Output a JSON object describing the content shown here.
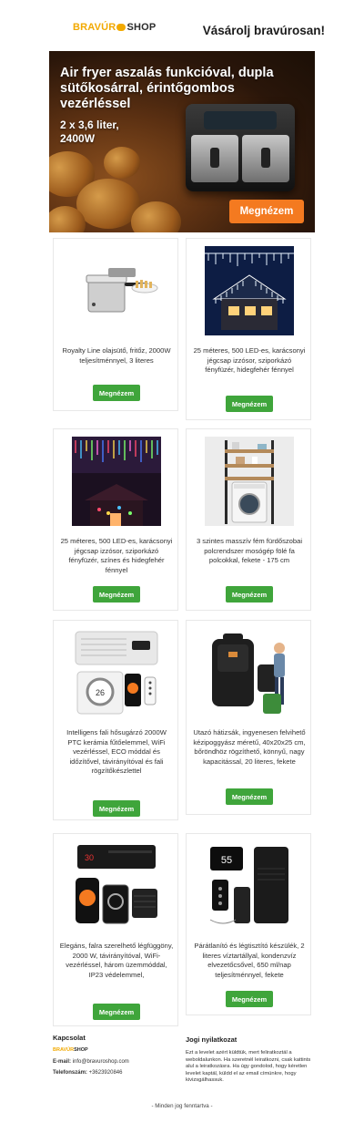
{
  "header": {
    "logo_part1": "BRAVÚR",
    "logo_part2": "SHOP",
    "slogan": "Vásárolj bravúrosan!"
  },
  "hero": {
    "title": "Air fryer aszalás funkcióval, dupla sütőkosárral, érintőgombos vezérléssel",
    "subtitle_line1": "2 x 3,6 liter,",
    "subtitle_line2": "2400W",
    "button_label": "Megnézem"
  },
  "products": [
    {
      "title": "Royalty Line olajsütő, fritőz, 2000W teljesítménnyel, 3 literes",
      "button_label": "Megnézem"
    },
    {
      "title": "25 méteres, 500 LED-es, karácsonyi jégcsap izzósor, sziporkázó fényfüzér, hidegfehér fénnyel",
      "button_label": "Megnézem"
    },
    {
      "title": "25 méteres, 500 LED-es, karácsonyi jégcsap izzósor, sziporkázó fényfüzér, színes és hidegfehér fénnyel",
      "button_label": "Megnézem"
    },
    {
      "title": "3 szintes masszív fém fürdőszobai polcrendszer mosógép fölé fa polcokkal, fekete - 175 cm",
      "button_label": "Megnézem"
    },
    {
      "title": "Intelligens fali hősugárzó 2000W PTC kerámia fűtőelemmel, WiFi vezérléssel, ECO móddal és időzítővel, távirányítóval és fali rögzítőkészlettel",
      "button_label": "Megnézem"
    },
    {
      "title": "Utazó hátizsák, ingyenesen felvihető kézipoggyász méretű, 40x20x25 cm, bőröndhöz rögzíthető, könnyű, nagy kapacitással, 20 literes, fekete",
      "button_label": "Megnézem"
    },
    {
      "title": "Elegáns, falra szerelhető légfüggöny, 2000 W, távirányítóval, WiFi-vezérléssel, három üzemmóddal, IP23 védelemmel,",
      "button_label": "Megnézem"
    },
    {
      "title": "Párátlanító és légtisztító készülék, 2 literes víztartállyal, kondenzvíz elvezetőcsővel, 650 ml/nap teljesítménnyel, fekete",
      "button_label": "Megnézem"
    }
  ],
  "footer": {
    "contact_heading": "Kapcsolat",
    "email_label": "E-mail:",
    "email_value": "info@bravuroshop.com",
    "phone_label": "Telefonszám:",
    "phone_value": "+3623920846",
    "legal_heading": "Jogi nyilatkozat",
    "legal_text": "Ezt a levelet azért küldtük, mert feliratkoztál a weboldalunkon. Ha szeretnél leiratkozni, csak kattints alul a leiratkozásra. Ha úgy gondolod, hogy kéretlen levelet kaptál, küldd el az email címünkre, hogy kivizsgálhassuk.",
    "rights": "- Minden jog fenntartva -"
  },
  "colors": {
    "accent_orange": "#f47a20",
    "button_green": "#3fa53b",
    "brand_yellow": "#f2a900"
  }
}
